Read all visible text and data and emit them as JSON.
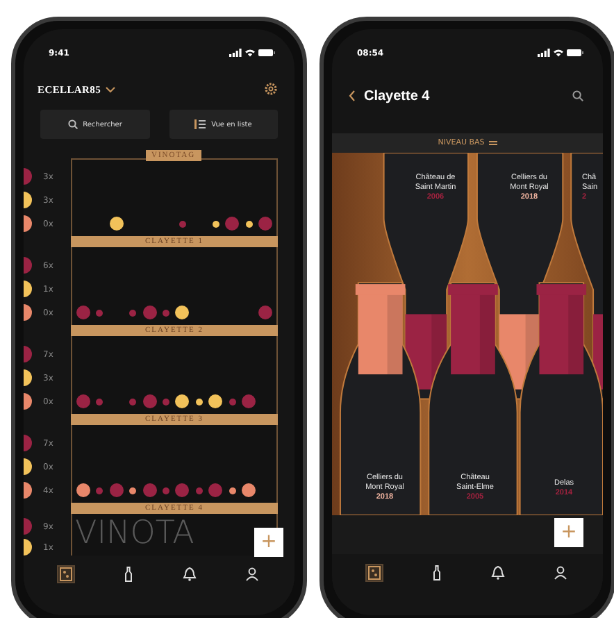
{
  "cellar_screen": {
    "status_time": "9:41",
    "cellar_name": "ECELLAR85",
    "buttons": [
      {
        "label": "Rechercher",
        "kind": "search"
      },
      {
        "label": "Vue en liste",
        "kind": "list"
      }
    ],
    "brand_tag": "VINOTAG",
    "shelves": [
      {
        "label": "CLAYETTE 1",
        "legend": [
          {
            "count": "3x",
            "color": "#9b2344"
          },
          {
            "count": "3x",
            "color": "#f2c25a"
          },
          {
            "count": "0x",
            "color": "#e8876a"
          }
        ],
        "bottles": [
          {
            "kind": "empty"
          },
          {
            "kind": "empty"
          },
          {
            "kind": "large",
            "color": "#f2c25a"
          },
          {
            "kind": "empty"
          },
          {
            "kind": "empty"
          },
          {
            "kind": "empty"
          },
          {
            "kind": "small",
            "color": "#9b2344"
          },
          {
            "kind": "empty"
          },
          {
            "kind": "small",
            "color": "#f2c25a"
          },
          {
            "kind": "large",
            "color": "#9b2344"
          },
          {
            "kind": "small",
            "color": "#f2c25a"
          },
          {
            "kind": "large",
            "color": "#9b2344"
          }
        ]
      },
      {
        "label": "CLAYETTE 2",
        "legend": [
          {
            "count": "6x",
            "color": "#9b2344"
          },
          {
            "count": "1x",
            "color": "#f2c25a"
          },
          {
            "count": "0x",
            "color": "#e8876a"
          }
        ],
        "bottles": [
          {
            "kind": "large",
            "color": "#9b2344"
          },
          {
            "kind": "small",
            "color": "#9b2344"
          },
          {
            "kind": "empty"
          },
          {
            "kind": "small",
            "color": "#9b2344"
          },
          {
            "kind": "large",
            "color": "#9b2344"
          },
          {
            "kind": "small",
            "color": "#9b2344"
          },
          {
            "kind": "large",
            "color": "#f2c25a"
          },
          {
            "kind": "empty"
          },
          {
            "kind": "empty"
          },
          {
            "kind": "empty"
          },
          {
            "kind": "empty"
          },
          {
            "kind": "large",
            "color": "#9b2344"
          }
        ]
      },
      {
        "label": "CLAYETTE 3",
        "legend": [
          {
            "count": "7x",
            "color": "#9b2344"
          },
          {
            "count": "3x",
            "color": "#f2c25a"
          },
          {
            "count": "0x",
            "color": "#e8876a"
          }
        ],
        "bottles": [
          {
            "kind": "large",
            "color": "#9b2344"
          },
          {
            "kind": "small",
            "color": "#9b2344"
          },
          {
            "kind": "empty"
          },
          {
            "kind": "small",
            "color": "#9b2344"
          },
          {
            "kind": "large",
            "color": "#9b2344"
          },
          {
            "kind": "small",
            "color": "#9b2344"
          },
          {
            "kind": "large",
            "color": "#f2c25a"
          },
          {
            "kind": "small",
            "color": "#f2c25a"
          },
          {
            "kind": "large",
            "color": "#f2c25a"
          },
          {
            "kind": "small",
            "color": "#9b2344"
          },
          {
            "kind": "large",
            "color": "#9b2344"
          }
        ]
      },
      {
        "label": "CLAYETTE 4",
        "legend": [
          {
            "count": "7x",
            "color": "#9b2344"
          },
          {
            "count": "0x",
            "color": "#f2c25a"
          },
          {
            "count": "4x",
            "color": "#e8876a"
          }
        ],
        "bottles": [
          {
            "kind": "large",
            "color": "#e8876a"
          },
          {
            "kind": "small",
            "color": "#9b2344"
          },
          {
            "kind": "large",
            "color": "#9b2344"
          },
          {
            "kind": "small",
            "color": "#e8876a"
          },
          {
            "kind": "large",
            "color": "#9b2344"
          },
          {
            "kind": "small",
            "color": "#9b2344"
          },
          {
            "kind": "large",
            "color": "#9b2344"
          },
          {
            "kind": "small",
            "color": "#9b2344"
          },
          {
            "kind": "large",
            "color": "#9b2344"
          },
          {
            "kind": "small",
            "color": "#e8876a"
          },
          {
            "kind": "large",
            "color": "#e8876a"
          }
        ]
      }
    ],
    "overflow_legend": [
      {
        "count": "9x",
        "color": "#9b2344"
      },
      {
        "count": "1x",
        "color": "#f2c25a"
      }
    ],
    "background_logo": "VINOTA",
    "add_button": "+",
    "tabs": [
      {
        "kind": "cellar",
        "selected": true
      },
      {
        "kind": "bottle",
        "selected": false
      },
      {
        "kind": "bell",
        "selected": false
      },
      {
        "kind": "profile",
        "selected": false
      }
    ]
  },
  "shelf_screen": {
    "status_time": "08:54",
    "title": "Clayette 4",
    "filter": "NIVEAU BAS",
    "top_bottles": [
      {
        "name": "Château de\nSaint Martin",
        "year": "2006",
        "color": "#a3223f"
      },
      {
        "name": "Celliers du\nMont Royal",
        "year": "2018",
        "color": "#f0b4a0"
      },
      {
        "name": "Châ\nSain",
        "year": "2",
        "color": "#a3223f"
      }
    ],
    "bottom_bottles": [
      {
        "name": "Celliers du\nMont Royal",
        "year": "2018",
        "color": "#f0b4a0"
      },
      {
        "name": "Château\nSaint-Elme",
        "year": "2005",
        "color": "#a3223f"
      },
      {
        "name": "Delas",
        "year": "2014",
        "color": "#a3223f"
      }
    ],
    "add_button": "+",
    "tabs": [
      {
        "kind": "cellar",
        "selected": true
      },
      {
        "kind": "bottle",
        "selected": false
      },
      {
        "kind": "bell",
        "selected": false
      },
      {
        "kind": "profile",
        "selected": false
      }
    ]
  }
}
